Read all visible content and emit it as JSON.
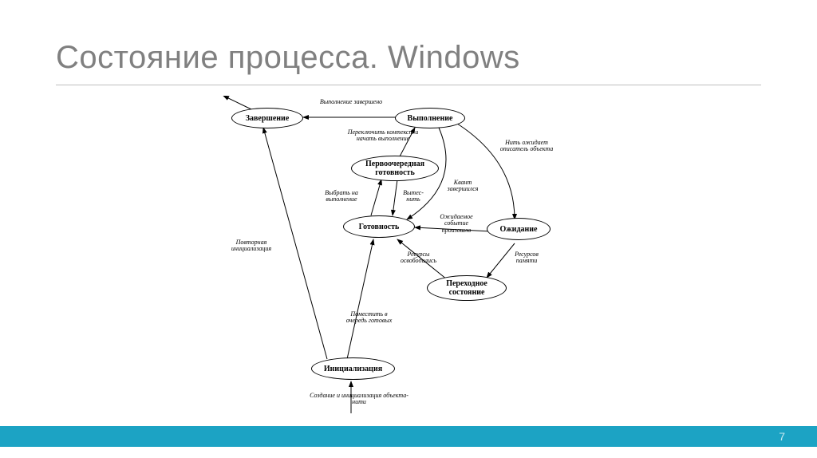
{
  "title": "Состояние процесса. Windows",
  "page_number": "7",
  "nodes": {
    "termination": "Завершение",
    "running": "Выполнение",
    "primary_ready": "Первоочередная\nготовность",
    "ready": "Готовность",
    "waiting": "Ожидание",
    "transition": "Переходное\nсостояние",
    "initialization": "Инициализация"
  },
  "edges": {
    "e1": "Выполнение\nзавершено",
    "e2": "Переключить\nконтекст и начать\nвыполнение",
    "e3": "Нить ожидает\nописатель\nобъекта",
    "e4": "Квант\nзавершился",
    "e5": "Выбрать на\nвыполнение",
    "e6": "Вытес-\nнить",
    "e7": "Ожидаемое\nсобытие\nпроизошло",
    "e8": "Ресурсы\nосвободились",
    "e9": "Ресурсов\nпамяти",
    "e10": "Повторная\nинициализация",
    "e11": "Поместить\nв очередь\nготовых",
    "e12": "Создание и инициализация\nобъекта-нити"
  }
}
